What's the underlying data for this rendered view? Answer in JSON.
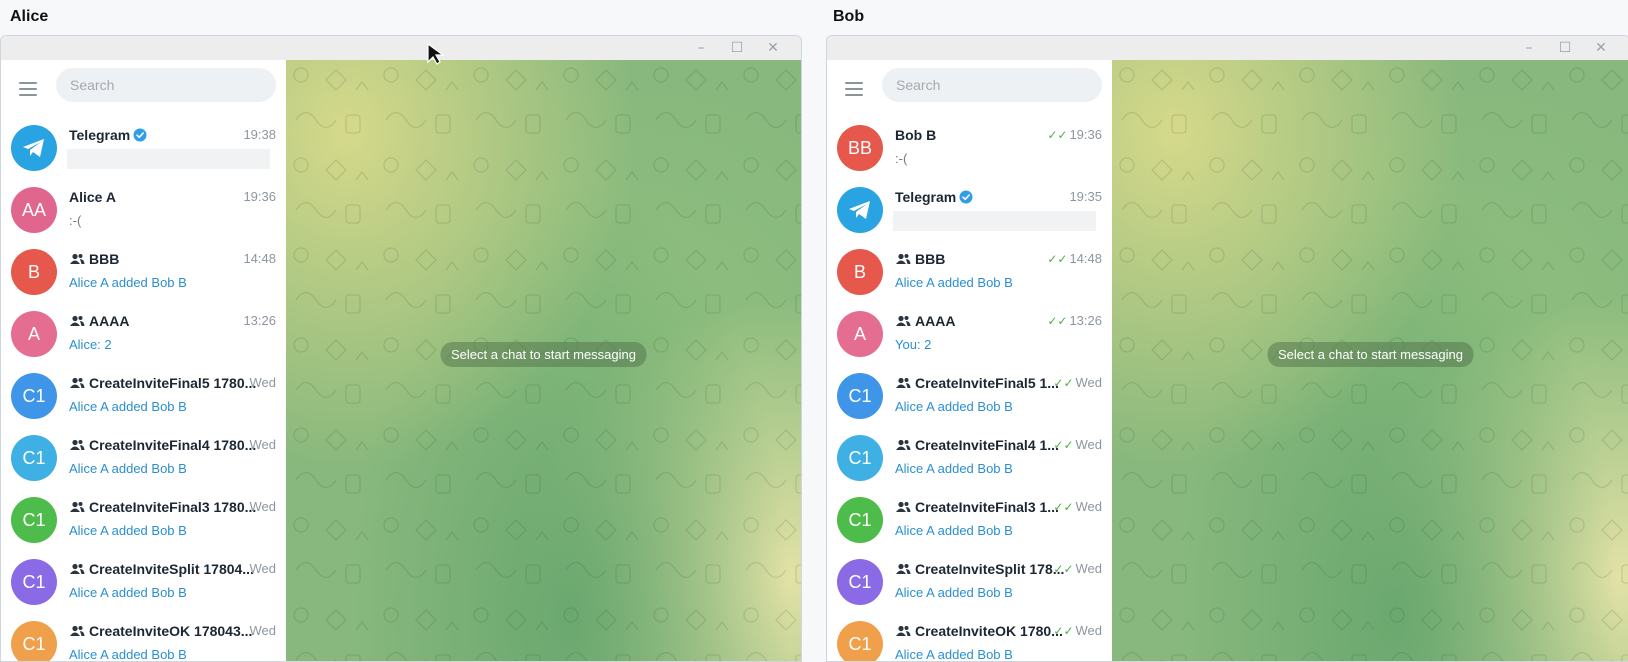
{
  "panes": [
    {
      "label": "Alice",
      "search_placeholder": "Search",
      "hint": "Select a chat to start messaging",
      "chats": [
        {
          "avatar": "",
          "title": "Telegram",
          "time": "19:38",
          "preview": "",
          "preview_style": "blank",
          "group": false,
          "verified": true,
          "ticks": false,
          "avatar_color": "#2aa3e2"
        },
        {
          "avatar": "AA",
          "title": "Alice A",
          "time": "19:36",
          "preview": ":-(",
          "preview_style": "gray",
          "group": false,
          "verified": false,
          "ticks": false,
          "avatar_color": "#e0668e"
        },
        {
          "avatar": "B",
          "title": "BBB",
          "time": "14:48",
          "preview": "Alice A added Bob B",
          "preview_style": "blue",
          "group": true,
          "verified": false,
          "ticks": false,
          "avatar_color": "#e5584b"
        },
        {
          "avatar": "A",
          "title": "AAAA",
          "time": "13:26",
          "preview": "Alice: 2",
          "preview_style": "blue",
          "group": true,
          "verified": false,
          "ticks": false,
          "avatar_color": "#e56d91"
        },
        {
          "avatar": "C1",
          "title": "CreateInviteFinal5 1780...",
          "time": "Wed",
          "preview": "Alice A added Bob B",
          "preview_style": "blue",
          "group": true,
          "verified": false,
          "ticks": false,
          "avatar_color": "#3f95e8"
        },
        {
          "avatar": "C1",
          "title": "CreateInviteFinal4 1780...",
          "time": "Wed",
          "preview": "Alice A added Bob B",
          "preview_style": "blue",
          "group": true,
          "verified": false,
          "ticks": false,
          "avatar_color": "#3fb0e4"
        },
        {
          "avatar": "C1",
          "title": "CreateInviteFinal3 1780...",
          "time": "Wed",
          "preview": "Alice A added Bob B",
          "preview_style": "blue",
          "group": true,
          "verified": false,
          "ticks": false,
          "avatar_color": "#4ebc4a"
        },
        {
          "avatar": "C1",
          "title": "CreateInviteSplit 17804...",
          "time": "Wed",
          "preview": "Alice A added Bob B",
          "preview_style": "blue",
          "group": true,
          "verified": false,
          "ticks": false,
          "avatar_color": "#8b6ae6"
        },
        {
          "avatar": "C1",
          "title": "CreateInviteOK 178043...",
          "time": "Wed",
          "preview": "Alice A added Bob B",
          "preview_style": "blue",
          "group": true,
          "verified": false,
          "ticks": false,
          "avatar_color": "#f0a04b"
        }
      ]
    },
    {
      "label": "Bob",
      "search_placeholder": "Search",
      "hint": "Select a chat to start messaging",
      "chats": [
        {
          "avatar": "BB",
          "title": "Bob B",
          "time": "19:36",
          "preview": ":-(",
          "preview_style": "gray",
          "group": false,
          "verified": false,
          "ticks": true,
          "avatar_color": "#e5584b"
        },
        {
          "avatar": "",
          "title": "Telegram",
          "time": "19:35",
          "preview": "",
          "preview_style": "blank",
          "group": false,
          "verified": true,
          "ticks": false,
          "avatar_color": "#2aa3e2"
        },
        {
          "avatar": "B",
          "title": "BBB",
          "time": "14:48",
          "preview": "Alice A added Bob B",
          "preview_style": "blue",
          "group": true,
          "verified": false,
          "ticks": true,
          "avatar_color": "#e5584b"
        },
        {
          "avatar": "A",
          "title": "AAAA",
          "time": "13:26",
          "preview": "You: 2",
          "preview_style": "blue",
          "group": true,
          "verified": false,
          "ticks": true,
          "avatar_color": "#e56d91"
        },
        {
          "avatar": "C1",
          "title": "CreateInviteFinal5 1...",
          "time": "Wed",
          "preview": "Alice A added Bob B",
          "preview_style": "blue",
          "group": true,
          "verified": false,
          "ticks": true,
          "avatar_color": "#3f95e8"
        },
        {
          "avatar": "C1",
          "title": "CreateInviteFinal4 1...",
          "time": "Wed",
          "preview": "Alice A added Bob B",
          "preview_style": "blue",
          "group": true,
          "verified": false,
          "ticks": true,
          "avatar_color": "#3fb0e4"
        },
        {
          "avatar": "C1",
          "title": "CreateInviteFinal3 1...",
          "time": "Wed",
          "preview": "Alice A added Bob B",
          "preview_style": "blue",
          "group": true,
          "verified": false,
          "ticks": true,
          "avatar_color": "#4ebc4a"
        },
        {
          "avatar": "C1",
          "title": "CreateInviteSplit 178...",
          "time": "Wed",
          "preview": "Alice A added Bob B",
          "preview_style": "blue",
          "group": true,
          "verified": false,
          "ticks": true,
          "avatar_color": "#8b6ae6"
        },
        {
          "avatar": "C1",
          "title": "CreateInviteOK 1780...",
          "time": "Wed",
          "preview": "Alice A added Bob B",
          "preview_style": "blue",
          "group": true,
          "verified": false,
          "ticks": true,
          "avatar_color": "#f0a04b"
        }
      ]
    }
  ],
  "window_controls": {
    "minimize": "–",
    "maximize": "☐",
    "close": "✕"
  },
  "icons": {
    "menu": "hamburger-icon",
    "verified": "verified-badge-icon",
    "group": "group-icon",
    "telegram": "telegram-plane-icon",
    "read": "double-check-icon",
    "cursor": "mouse-cursor-icon"
  }
}
